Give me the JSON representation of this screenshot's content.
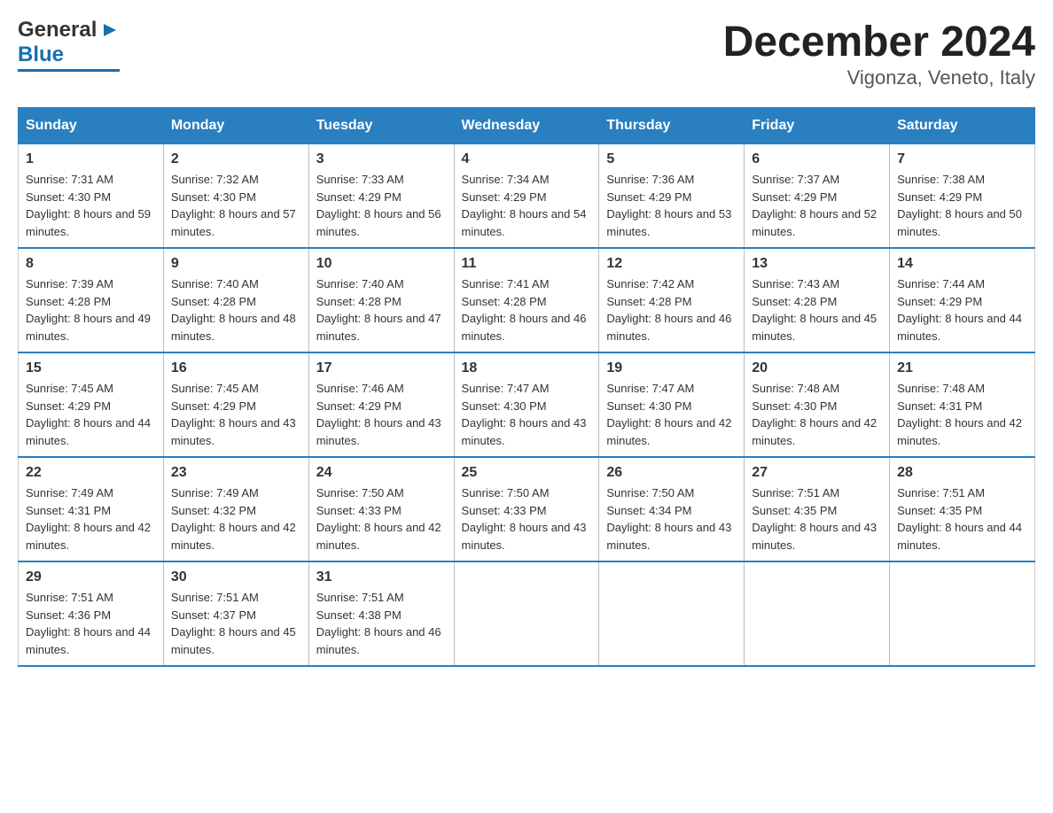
{
  "header": {
    "logo_general": "General",
    "logo_blue": "Blue",
    "title": "December 2024",
    "subtitle": "Vigonza, Veneto, Italy"
  },
  "days_of_week": [
    "Sunday",
    "Monday",
    "Tuesday",
    "Wednesday",
    "Thursday",
    "Friday",
    "Saturday"
  ],
  "weeks": [
    [
      {
        "day": "1",
        "sunrise": "7:31 AM",
        "sunset": "4:30 PM",
        "daylight": "8 hours and 59 minutes."
      },
      {
        "day": "2",
        "sunrise": "7:32 AM",
        "sunset": "4:30 PM",
        "daylight": "8 hours and 57 minutes."
      },
      {
        "day": "3",
        "sunrise": "7:33 AM",
        "sunset": "4:29 PM",
        "daylight": "8 hours and 56 minutes."
      },
      {
        "day": "4",
        "sunrise": "7:34 AM",
        "sunset": "4:29 PM",
        "daylight": "8 hours and 54 minutes."
      },
      {
        "day": "5",
        "sunrise": "7:36 AM",
        "sunset": "4:29 PM",
        "daylight": "8 hours and 53 minutes."
      },
      {
        "day": "6",
        "sunrise": "7:37 AM",
        "sunset": "4:29 PM",
        "daylight": "8 hours and 52 minutes."
      },
      {
        "day": "7",
        "sunrise": "7:38 AM",
        "sunset": "4:29 PM",
        "daylight": "8 hours and 50 minutes."
      }
    ],
    [
      {
        "day": "8",
        "sunrise": "7:39 AM",
        "sunset": "4:28 PM",
        "daylight": "8 hours and 49 minutes."
      },
      {
        "day": "9",
        "sunrise": "7:40 AM",
        "sunset": "4:28 PM",
        "daylight": "8 hours and 48 minutes."
      },
      {
        "day": "10",
        "sunrise": "7:40 AM",
        "sunset": "4:28 PM",
        "daylight": "8 hours and 47 minutes."
      },
      {
        "day": "11",
        "sunrise": "7:41 AM",
        "sunset": "4:28 PM",
        "daylight": "8 hours and 46 minutes."
      },
      {
        "day": "12",
        "sunrise": "7:42 AM",
        "sunset": "4:28 PM",
        "daylight": "8 hours and 46 minutes."
      },
      {
        "day": "13",
        "sunrise": "7:43 AM",
        "sunset": "4:28 PM",
        "daylight": "8 hours and 45 minutes."
      },
      {
        "day": "14",
        "sunrise": "7:44 AM",
        "sunset": "4:29 PM",
        "daylight": "8 hours and 44 minutes."
      }
    ],
    [
      {
        "day": "15",
        "sunrise": "7:45 AM",
        "sunset": "4:29 PM",
        "daylight": "8 hours and 44 minutes."
      },
      {
        "day": "16",
        "sunrise": "7:45 AM",
        "sunset": "4:29 PM",
        "daylight": "8 hours and 43 minutes."
      },
      {
        "day": "17",
        "sunrise": "7:46 AM",
        "sunset": "4:29 PM",
        "daylight": "8 hours and 43 minutes."
      },
      {
        "day": "18",
        "sunrise": "7:47 AM",
        "sunset": "4:30 PM",
        "daylight": "8 hours and 43 minutes."
      },
      {
        "day": "19",
        "sunrise": "7:47 AM",
        "sunset": "4:30 PM",
        "daylight": "8 hours and 42 minutes."
      },
      {
        "day": "20",
        "sunrise": "7:48 AM",
        "sunset": "4:30 PM",
        "daylight": "8 hours and 42 minutes."
      },
      {
        "day": "21",
        "sunrise": "7:48 AM",
        "sunset": "4:31 PM",
        "daylight": "8 hours and 42 minutes."
      }
    ],
    [
      {
        "day": "22",
        "sunrise": "7:49 AM",
        "sunset": "4:31 PM",
        "daylight": "8 hours and 42 minutes."
      },
      {
        "day": "23",
        "sunrise": "7:49 AM",
        "sunset": "4:32 PM",
        "daylight": "8 hours and 42 minutes."
      },
      {
        "day": "24",
        "sunrise": "7:50 AM",
        "sunset": "4:33 PM",
        "daylight": "8 hours and 42 minutes."
      },
      {
        "day": "25",
        "sunrise": "7:50 AM",
        "sunset": "4:33 PM",
        "daylight": "8 hours and 43 minutes."
      },
      {
        "day": "26",
        "sunrise": "7:50 AM",
        "sunset": "4:34 PM",
        "daylight": "8 hours and 43 minutes."
      },
      {
        "day": "27",
        "sunrise": "7:51 AM",
        "sunset": "4:35 PM",
        "daylight": "8 hours and 43 minutes."
      },
      {
        "day": "28",
        "sunrise": "7:51 AM",
        "sunset": "4:35 PM",
        "daylight": "8 hours and 44 minutes."
      }
    ],
    [
      {
        "day": "29",
        "sunrise": "7:51 AM",
        "sunset": "4:36 PM",
        "daylight": "8 hours and 44 minutes."
      },
      {
        "day": "30",
        "sunrise": "7:51 AM",
        "sunset": "4:37 PM",
        "daylight": "8 hours and 45 minutes."
      },
      {
        "day": "31",
        "sunrise": "7:51 AM",
        "sunset": "4:38 PM",
        "daylight": "8 hours and 46 minutes."
      },
      {
        "day": "",
        "sunrise": "",
        "sunset": "",
        "daylight": ""
      },
      {
        "day": "",
        "sunrise": "",
        "sunset": "",
        "daylight": ""
      },
      {
        "day": "",
        "sunrise": "",
        "sunset": "",
        "daylight": ""
      },
      {
        "day": "",
        "sunrise": "",
        "sunset": "",
        "daylight": ""
      }
    ]
  ]
}
